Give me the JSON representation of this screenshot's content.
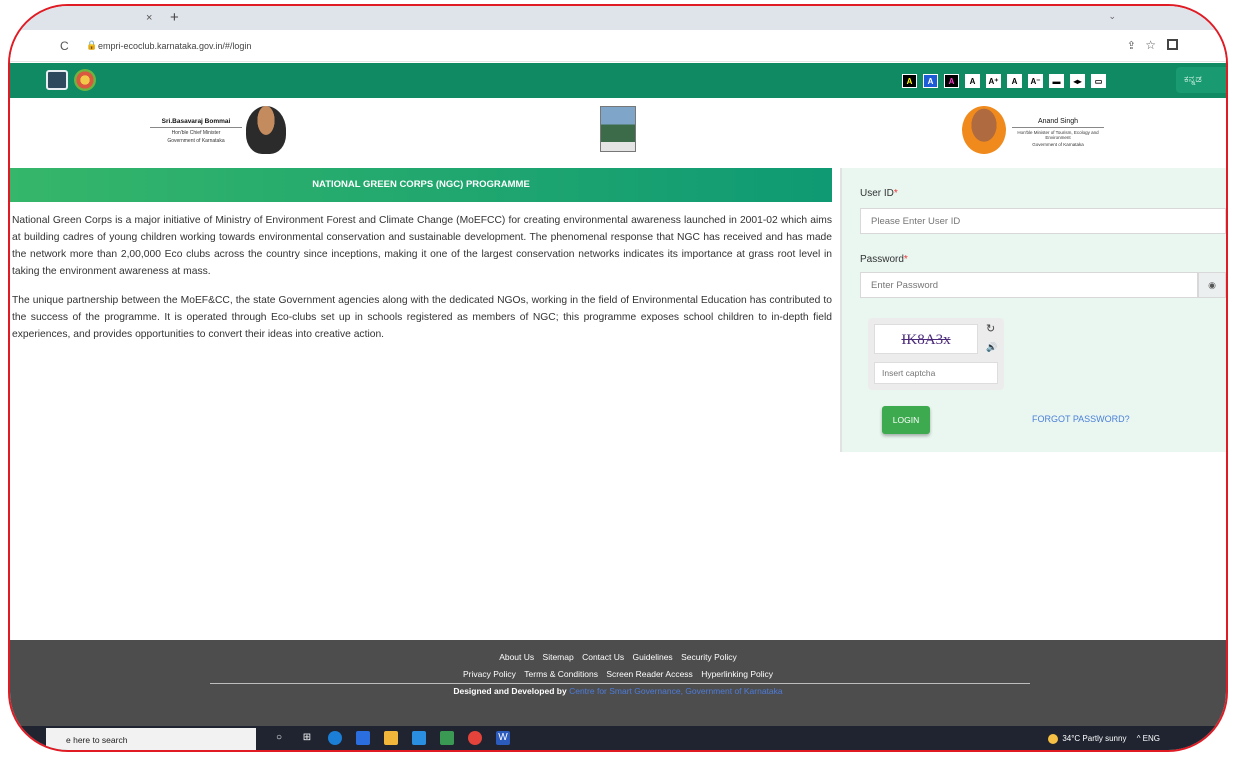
{
  "browser": {
    "tab_close": "×",
    "tab_new": "+",
    "url": "empri-ecoclub.karnataka.gov.in/#/login"
  },
  "header": {
    "accessibility_buttons": [
      {
        "label": "A",
        "bg": "#000000",
        "fg": "#ffff00"
      },
      {
        "label": "A",
        "bg": "#1e5bd6",
        "fg": "#ffffff"
      },
      {
        "label": "A",
        "bg": "#000000",
        "fg": "#ff3fd0"
      },
      {
        "label": "A",
        "bg": "#ffffff",
        "fg": "#000000"
      },
      {
        "label": "A⁺",
        "bg": "#ffffff",
        "fg": "#000000"
      },
      {
        "label": "A",
        "bg": "#ffffff",
        "fg": "#000000"
      },
      {
        "label": "A⁻",
        "bg": "#ffffff",
        "fg": "#000000"
      },
      {
        "label": "▬",
        "bg": "#ffffff",
        "fg": "#000000"
      },
      {
        "label": "◂▸",
        "bg": "#ffffff",
        "fg": "#000000"
      },
      {
        "label": "▭",
        "bg": "#ffffff",
        "fg": "#000000"
      }
    ],
    "language": "ಕನ್ನಡ"
  },
  "banner": {
    "cm_name": "Sri.Basavaraj Bommai",
    "cm_title_1": "Hon'ble Chief Minister",
    "cm_title_2": "Government of Karnataka",
    "minister_name": "Anand Singh",
    "minister_title_1": "Hon'ble Minister of Tourism, Ecology and Environment",
    "minister_title_2": "Government of Karnataka"
  },
  "main": {
    "title": "NATIONAL GREEN CORPS (NGC) PROGRAMME",
    "paragraph_1": "National Green Corps is a major initiative of Ministry of Environment Forest and Climate Change (MoEFCC) for creating environmental awareness launched in 2001-02 which aims at building cadres of young children working towards environmental conservation and sustainable development. The phenomenal response that NGC has received and has made the network more than 2,00,000 Eco clubs across the country since inceptions, making it one of the largest conservation networks indicates its importance at grass root level in taking the environment awareness at mass.",
    "paragraph_2": "The unique partnership between the MoEF&CC, the state Government agencies along with the dedicated NGOs, working in the field of Environmental Education has contributed to the success of the programme. It is operated through Eco-clubs set up in schools registered as members of NGC; this programme exposes school children to in-depth field experiences, and provides opportunities to convert their ideas into creative action."
  },
  "login": {
    "userid_label": "User ID",
    "userid_placeholder": "Please Enter User ID",
    "password_label": "Password",
    "password_placeholder": "Enter Password",
    "required_mark": "*",
    "captcha_text": "IK8A3x",
    "captcha_placeholder": "Insert captcha",
    "login_button": "LOGIN",
    "forgot_password": "FORGOT PASSWORD?"
  },
  "footer": {
    "row1": [
      "About Us",
      "Sitemap",
      "Contact Us",
      "Guidelines",
      "Security Policy"
    ],
    "row2": [
      "Privacy Policy",
      "Terms & Conditions",
      "Screen Reader Access",
      "Hyperlinking Policy"
    ],
    "credit_prefix": "Designed and Developed by",
    "credit_org": "Centre for Smart Governance, Government of Karnataka"
  },
  "taskbar": {
    "search_text": "e here to search",
    "weather": "34°C Partly sunny",
    "tray_extra": "^ ENG"
  }
}
